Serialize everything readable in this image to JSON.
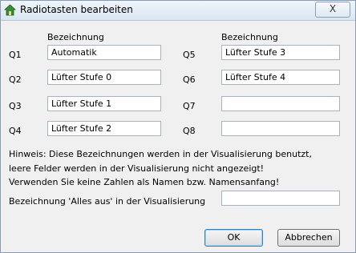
{
  "window": {
    "title": "Radiotasten bearbeiten",
    "close_label": "X"
  },
  "columns": {
    "left_header": "Bezeichnung",
    "right_header": "Bezeichnung"
  },
  "rows_left": [
    {
      "label": "Q1",
      "value": "Automatik"
    },
    {
      "label": "Q2",
      "value": "Lüfter Stufe 0"
    },
    {
      "label": "Q3",
      "value": "Lüfter Stufe 1"
    },
    {
      "label": "Q4",
      "value": "Lüfter Stufe 2"
    }
  ],
  "rows_right": [
    {
      "label": "Q5",
      "value": "Lüfter Stufe 3"
    },
    {
      "label": "Q6",
      "value": "Lüfter Stufe 4"
    },
    {
      "label": "Q7",
      "value": ""
    },
    {
      "label": "Q8",
      "value": ""
    }
  ],
  "hint": {
    "line1": "Hinweis: Diese Bezeichnungen werden in der Visualisierung benutzt,",
    "line2": "leere Felder werden in der Visualisierung nicht angezeigt!",
    "line3": "Verwenden Sie keine Zahlen als Namen bzw. Namensanfang!"
  },
  "alles_aus": {
    "label": "Bezeichnung 'Alles aus' in der Visualisierung",
    "value": ""
  },
  "buttons": {
    "ok": "OK",
    "cancel": "Abbrechen"
  },
  "icons": {
    "title_icon": "home-icon"
  }
}
